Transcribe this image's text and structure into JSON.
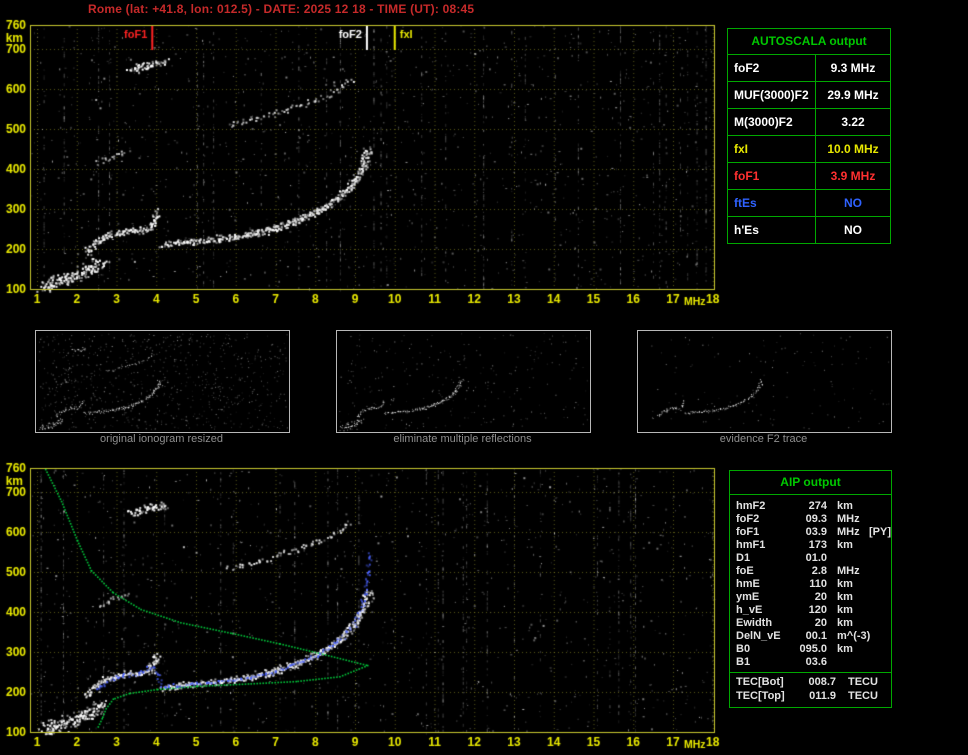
{
  "header": {
    "title": "Rome (lat: +41.8, lon: 012.5) - DATE: 2025 12 18 - TIME (UT): 08:45"
  },
  "autoscala": {
    "title": "AUTOSCALA output",
    "rows": [
      {
        "label": "foF2",
        "value": "9.3 MHz",
        "color": "#ffffff"
      },
      {
        "label": "MUF(3000)F2",
        "value": "29.9 MHz",
        "color": "#ffffff"
      },
      {
        "label": "M(3000)F2",
        "value": "3.22",
        "color": "#ffffff"
      },
      {
        "label": "fxI",
        "value": "10.0 MHz",
        "color": "#e8e800"
      },
      {
        "label": "foF1",
        "value": "3.9 MHz",
        "color": "#ff3030"
      },
      {
        "label": "ftEs",
        "value": "NO",
        "color": "#2f62ff"
      },
      {
        "label": "h'Es",
        "value": "NO",
        "color": "#ffffff"
      }
    ]
  },
  "thumbnails": [
    {
      "caption": "original ionogram resized",
      "traces": [
        "es",
        "f1",
        "f2",
        "f2x",
        "hop2",
        "arc",
        "patch"
      ],
      "noise_dots": 750,
      "seed": 5
    },
    {
      "caption": "eliminate multiple reflections",
      "traces": [
        "es",
        "f1",
        "f2",
        "f2x"
      ],
      "noise_dots": 260,
      "seed": 6
    },
    {
      "caption": "evidence F2 trace",
      "traces": [
        "f1",
        "f2"
      ],
      "noise_dots": 130,
      "seed": 9
    }
  ],
  "aip": {
    "title": "AIP output",
    "rows": [
      {
        "label": "hmF2",
        "value": "274",
        "unit": "km",
        "note": ""
      },
      {
        "label": "foF2",
        "value": "09.3",
        "unit": "MHz",
        "note": ""
      },
      {
        "label": "foF1",
        "value": "03.9",
        "unit": "MHz",
        "note": "[PY]"
      },
      {
        "label": "hmF1",
        "value": "173",
        "unit": "km",
        "note": ""
      },
      {
        "label": "D1",
        "value": "01.0",
        "unit": "",
        "note": ""
      },
      {
        "label": "foE",
        "value": "2.8",
        "unit": "MHz",
        "note": ""
      },
      {
        "label": "hmE",
        "value": "110",
        "unit": "km",
        "note": ""
      },
      {
        "label": "ymE",
        "value": "20",
        "unit": "km",
        "note": ""
      },
      {
        "label": "h_vE",
        "value": "120",
        "unit": "km",
        "note": ""
      },
      {
        "label": "Ewidth",
        "value": "20",
        "unit": "km",
        "note": ""
      },
      {
        "label": "DelN_vE",
        "value": "00.1",
        "unit": "m^(-3)",
        "note": ""
      },
      {
        "label": "B0",
        "value": "095.0",
        "unit": "km",
        "note": ""
      },
      {
        "label": "B1",
        "value": "03.6",
        "unit": "",
        "note": ""
      }
    ],
    "tec_rows": [
      {
        "label": "TEC[Bot]",
        "value": "008.7",
        "unit": "TECU"
      },
      {
        "label": "TEC[Top]",
        "value": "011.9",
        "unit": "TECU"
      }
    ]
  },
  "chart_data": [
    {
      "type": "scatter",
      "title": "ionogram with autoscaled characteristic frequencies",
      "xlabel": "MHz",
      "ylabel": "km",
      "xlim": [
        1,
        18
      ],
      "ylim": [
        100,
        760
      ],
      "x_ticks": [
        1,
        2,
        3,
        4,
        5,
        6,
        7,
        8,
        9,
        10,
        11,
        12,
        13,
        14,
        15,
        16,
        17,
        18
      ],
      "y_ticks": [
        760,
        700,
        600,
        500,
        400,
        300,
        200,
        100
      ],
      "grid_y": [
        200,
        300,
        400,
        500,
        600,
        700
      ],
      "legend": "off",
      "grid": "dotted-yellow",
      "markers": [
        {
          "label": "foF1",
          "x": 3.9,
          "color": "#ff2222",
          "side": "left"
        },
        {
          "label": "foF2",
          "x": 9.3,
          "color": "#ffffff",
          "side": "left"
        },
        {
          "label": "fxI",
          "x": 10.0,
          "color": "#e8e800",
          "side": "right"
        }
      ],
      "seed": 11,
      "noise_dots": 1100,
      "noise_columns": 30,
      "traces": [
        {
          "name": "es",
          "color": "#ffffff",
          "spread": 8,
          "density": 5,
          "points": [
            [
              1.15,
              107
            ],
            [
              1.45,
              115
            ],
            [
              1.8,
              128
            ],
            [
              2.15,
              143
            ],
            [
              2.45,
              158
            ],
            [
              2.65,
              172
            ]
          ]
        },
        {
          "name": "f1",
          "color": "#ffffff",
          "spread": 4,
          "density": 2.5,
          "points": [
            [
              2.25,
              192
            ],
            [
              2.5,
              220
            ],
            [
              2.8,
              236
            ],
            [
              3.2,
              246
            ],
            [
              3.6,
              249
            ],
            [
              3.85,
              258
            ],
            [
              3.97,
              280
            ],
            [
              4.03,
              297
            ]
          ]
        },
        {
          "name": "f2",
          "color": "#ffffff",
          "spread": 4,
          "density": 2.5,
          "points": [
            [
              4.15,
              212
            ],
            [
              4.6,
              218
            ],
            [
              5.2,
              223
            ],
            [
              6.0,
              232
            ],
            [
              6.8,
              247
            ],
            [
              7.5,
              270
            ],
            [
              8.1,
              298
            ],
            [
              8.6,
              333
            ],
            [
              9.0,
              376
            ],
            [
              9.2,
              418
            ],
            [
              9.3,
              455
            ]
          ]
        },
        {
          "name": "f2x",
          "color": "#d8d8d8",
          "spread": 3,
          "density": 1.3,
          "points": [
            [
              6.2,
              240
            ],
            [
              7.0,
              260
            ],
            [
              7.8,
              286
            ],
            [
              8.4,
              316
            ],
            [
              8.9,
              356
            ],
            [
              9.25,
              408
            ],
            [
              9.45,
              452
            ]
          ]
        },
        {
          "name": "hop2",
          "color": "#e8e8e8",
          "spread": 3.5,
          "density": 1.2,
          "points": [
            [
              5.8,
              512
            ],
            [
              6.5,
              528
            ],
            [
              7.2,
              546
            ],
            [
              7.9,
              570
            ],
            [
              8.5,
              598
            ],
            [
              8.9,
              630
            ]
          ]
        },
        {
          "name": "arc",
          "color": "#cccccc",
          "spread": 3,
          "density": 1.0,
          "points": [
            [
              2.5,
              418
            ],
            [
              2.9,
              432
            ],
            [
              3.3,
              450
            ]
          ]
        },
        {
          "name": "patch",
          "color": "#ffffff",
          "spread": 5,
          "density": 2.5,
          "points": [
            [
              3.35,
              648
            ],
            [
              3.6,
              658
            ],
            [
              3.9,
              664
            ],
            [
              4.2,
              668
            ]
          ]
        }
      ]
    },
    {
      "type": "scatter",
      "title": "ionogram with restored electron density profile and autoscaled trace",
      "xlabel": "MHz",
      "ylabel": "km",
      "xlim": [
        1,
        18
      ],
      "ylim": [
        100,
        760
      ],
      "x_ticks": [
        1,
        2,
        3,
        4,
        5,
        6,
        7,
        8,
        9,
        10,
        11,
        12,
        13,
        14,
        15,
        16,
        17,
        18
      ],
      "y_ticks": [
        760,
        700,
        600,
        500,
        400,
        300,
        200,
        100
      ],
      "grid_y": [
        200,
        300,
        400,
        500,
        600,
        700
      ],
      "legend": "off",
      "grid": "dotted-yellow",
      "markers": [],
      "seed": 23,
      "noise_dots": 1000,
      "noise_columns": 28,
      "traces_from": 0,
      "traces": [
        {
          "name": "profile",
          "style": "dotline",
          "color": "#00d23c",
          "points": [
            [
              1.2,
              758
            ],
            [
              1.6,
              678
            ],
            [
              2.0,
              580
            ],
            [
              2.35,
              505
            ],
            [
              2.9,
              450
            ],
            [
              3.6,
              408
            ],
            [
              4.6,
              375
            ],
            [
              5.9,
              348
            ],
            [
              7.1,
              322
            ],
            [
              8.1,
              298
            ],
            [
              8.9,
              278
            ],
            [
              9.3,
              268
            ],
            [
              8.6,
              240
            ],
            [
              7.5,
              228
            ],
            [
              6.3,
              222
            ],
            [
              5.0,
              216
            ],
            [
              4.0,
              208
            ],
            [
              3.3,
              198
            ],
            [
              2.9,
              184
            ],
            [
              2.72,
              160
            ],
            [
              2.62,
              135
            ],
            [
              2.5,
              110
            ]
          ]
        },
        {
          "name": "autotrace",
          "color": "#4a62ff",
          "spread": 2.5,
          "density": 0.9,
          "points": [
            [
              2.5,
              210
            ],
            [
              3.0,
              240
            ],
            [
              3.5,
              247
            ],
            [
              3.9,
              268
            ],
            [
              4.15,
              215
            ],
            [
              5.0,
              222
            ],
            [
              6.0,
              232
            ],
            [
              6.8,
              247
            ],
            [
              7.5,
              270
            ],
            [
              8.1,
              298
            ],
            [
              8.6,
              333
            ],
            [
              9.0,
              376
            ],
            [
              9.2,
              430
            ],
            [
              9.3,
              500
            ],
            [
              9.33,
              552
            ]
          ]
        }
      ]
    }
  ]
}
